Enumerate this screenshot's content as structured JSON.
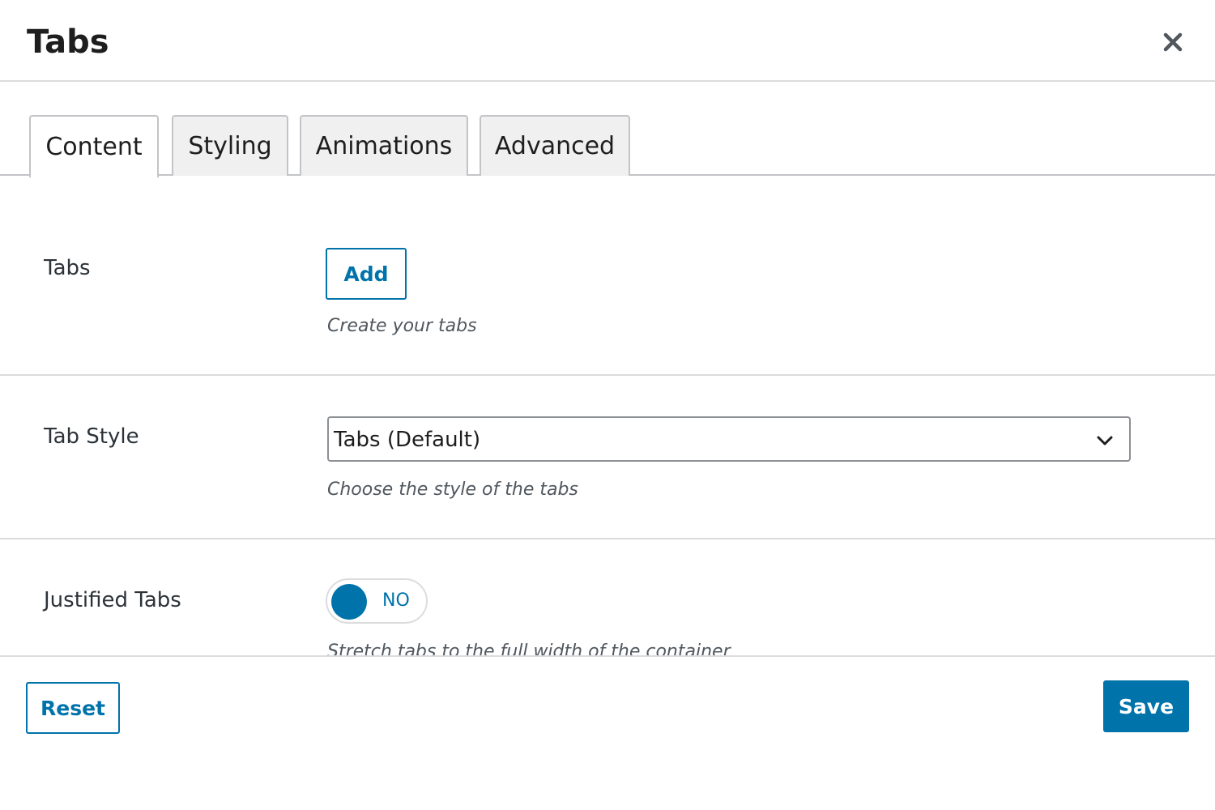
{
  "header": {
    "title": "Tabs",
    "close_icon": "close-icon"
  },
  "tabs": [
    {
      "label": "Content",
      "active": true
    },
    {
      "label": "Styling",
      "active": false
    },
    {
      "label": "Animations",
      "active": false
    },
    {
      "label": "Advanced",
      "active": false
    }
  ],
  "fields": {
    "tabs": {
      "label": "Tabs",
      "button_label": "Add",
      "help": "Create your tabs"
    },
    "tab_style": {
      "label": "Tab Style",
      "selected": "Tabs (Default)",
      "help": "Choose the style of the tabs",
      "icon": "chevron-down-icon"
    },
    "justified_tabs": {
      "label": "Justified Tabs",
      "toggle_text": "NO",
      "value": false,
      "help": "Stretch tabs to the full width of the container"
    }
  },
  "footer": {
    "reset_label": "Reset",
    "save_label": "Save"
  },
  "colors": {
    "accent": "#0073aa",
    "border": "#c3c4c7",
    "divider": "#dcdcde"
  }
}
